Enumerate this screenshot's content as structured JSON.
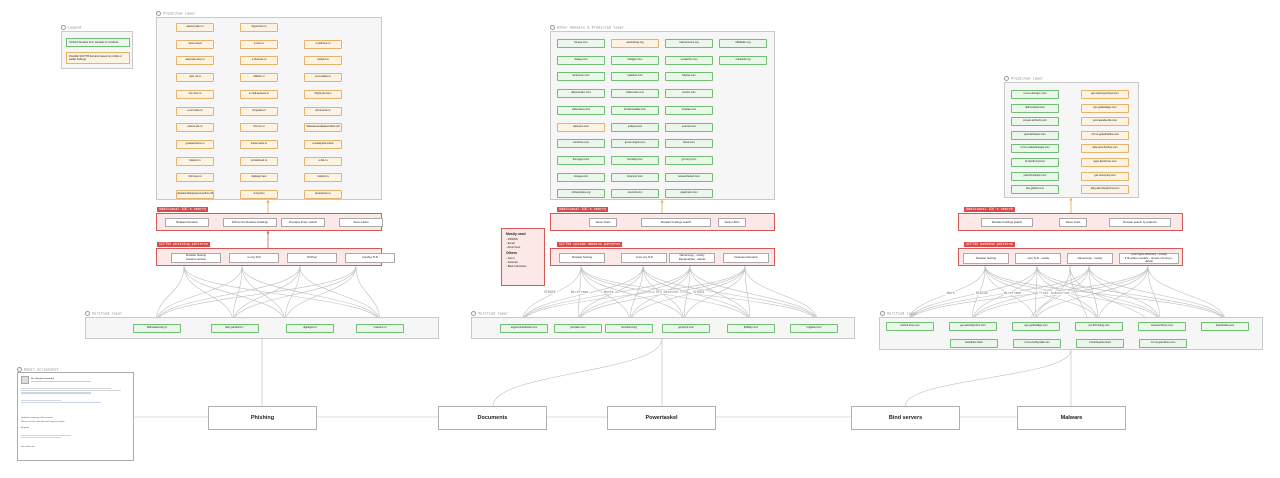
{
  "legend": {
    "title": "Legend",
    "verified_text": "Verified domains from samples or incidents",
    "predicted_text": "Possible SCF755 domains based on profile or earlier findings",
    "colors": {
      "verified": "#6fbf73",
      "predicted": "#e6b36a",
      "pivot": "#d45a5a"
    }
  },
  "panels": {
    "predicted_left": "Predicted layer",
    "verified_left": "Verified layer",
    "predicted_mid": "Other domains & Predicted layer",
    "verified_mid": "Verified layer",
    "predicted_right": "Predicted layer",
    "verified_right": "Verified layer"
  },
  "left": {
    "predicted": [
      [
        "ateonymdex.ru",
        "frepsit-link.ru",
        ""
      ],
      [
        "ndmo-cevel",
        "k-rbto.ru",
        "e-redirune.ru"
      ],
      [
        "aetyrode-drop.ru",
        "e-thuouse.ru",
        "roodpro.ru"
      ],
      [
        "urpu-rut.ru",
        "lsBode.ru",
        "a-vnnuldee.ru"
      ],
      [
        "rko-mho.ru",
        "e-mail-apesent.ru",
        "bbght-pro.item"
      ],
      [
        "e-mrrmdse.ru",
        "rctrposite.ru",
        "dnrumente.ru"
      ],
      [
        "otecne-ide.ru",
        "flum-fo.ru",
        "flldsealumestlpaeecodins.zdl"
      ],
      [
        "gruwael-there.ru",
        "tracte-todrs.ru",
        "e-rkeafpeds.online"
      ],
      [
        "tolelent.ru",
        "st-facebook.ru",
        "e-flat.ru"
      ],
      [
        "rcbrmeve.ru",
        "digiteign.item",
        "modpro.ru"
      ],
      [
        "tsbadeendlestpoeomoedins.zdl",
        "d-iny.item",
        "preesdmen.ru"
      ]
    ],
    "pivot_title": "Additional IOC's search",
    "pivots": [
      "Related Domains",
      "DrPost Xiu Russian Holdings",
      "Domains Frazy search",
      "Same Hosts"
    ],
    "patterns_title": "SCF755 phishing patterns",
    "patterns": [
      "Russian hosting\nAmazon service",
      "ru.org TLD",
      "DrrPost",
      "Another TLD"
    ],
    "verified": [
      "dibfusasecurity.ru",
      "dels-yandexl.fo...",
      "digitelgov.ru",
      "mseezur.ru"
    ]
  },
  "mid": {
    "predicted": [
      [
        "frontpe.com",
        "wonkelmay.org",
        "trabconcoms.org",
        "lt9bdadic.org"
      ],
      [
        "drapey.com",
        "heltigen.com",
        "eovlacrhn.com",
        "ntlefetshi.org"
      ],
      [
        "lambenen.com",
        "caladent.com",
        "bbpfas.com",
        ""
      ],
      [
        "lablyuenden.com",
        "callenrules.com",
        "orentm.com",
        ""
      ],
      [
        "wabrudees.com",
        "buntlemuelder.com",
        "rlroatae.com",
        ""
      ],
      [
        "adreeten.com",
        "jordpea.com",
        "enenstr.com",
        ""
      ],
      [
        "comtbore.com",
        "govermingrls.com",
        "flowtr.com",
        ""
      ],
      [
        "dompgen.com",
        "lornelbiy.com",
        "gmmmy.com",
        ""
      ],
      [
        "storgee.com",
        "bopcsort.com",
        "teteeerifested.com",
        ""
      ],
      [
        "inflowenlpes.org",
        "oevcndi.com",
        "papdnstor.com",
        ""
      ]
    ],
    "predicted_kind": [
      [
        "v",
        "p",
        "v",
        "v"
      ],
      [
        "v",
        "v",
        "v",
        "v"
      ],
      [
        "v",
        "v",
        "v",
        ""
      ],
      [
        "v",
        "v",
        "v",
        ""
      ],
      [
        "v",
        "v",
        "v",
        ""
      ],
      [
        "p",
        "v",
        "v",
        ""
      ],
      [
        "v",
        "v",
        "v",
        ""
      ],
      [
        "v",
        "v",
        "v",
        ""
      ],
      [
        "v",
        "v",
        "v",
        ""
      ],
      [
        "v",
        "v",
        "v",
        ""
      ]
    ],
    "pivot_title": "Additional IOC's search",
    "pivots": [
      "Same hosts",
      "Russian hostings search",
      "Same URLs"
    ],
    "patterns_title": "SCF755 upload domains patterns",
    "patterns": [
      "Russian hosting",
      ".com/.org TLD",
      "Name/copy - mostly\nfilename(file) - defeat",
      "Overused domains"
    ],
    "branch_labels": [
      "VIRUSE",
      "Wireframe",
      "Waste",
      "GFX Detector",
      "VIRUSE"
    ],
    "verified": [
      "avgservicesdsoke.com",
      "jerareke.com",
      "renonlend.org",
      "gerpocnt.com",
      "flnffidey.com",
      "rnlgeloe.com"
    ]
  },
  "mostly": {
    "title1": "Mostly used",
    "items1": [
      "- DDDNS",
      "- Email",
      "- Ahornhost"
    ],
    "title2": "Others",
    "items2": [
      "- Noon",
      "- Selectel",
      "- Beat Industries"
    ]
  },
  "right": {
    "predicted": [
      [
        "roomo-deregcn.com",
        "apc-atuonypunfrew.com"
      ],
      [
        "dellrcordand.com",
        "ppc-getfieldapp.com"
      ],
      [
        "pnneet-anhordo.com",
        "ponmeesdeurds.com"
      ],
      [
        "apd-debbiearr.com",
        "rrrrmo-gebebhafloo.com"
      ],
      [
        "rrrrmo-safesdlvangel.com",
        "defe-olumbcnline.com"
      ],
      [
        "dr-ilandlrned.com",
        "regis-deirsfmoe.com"
      ],
      [
        "pelenihusfrape.com",
        "get-houd-ploy.com"
      ],
      [
        "fivo-globeli.com",
        "plbg-abumbophrrnw.com"
      ]
    ],
    "pivot_title": "Additional IOC's search",
    "pivots": [
      "Russian hostings search",
      "Same hosts",
      "Domain search by patterns"
    ],
    "patterns_title": "SCF755 backend patterns",
    "patterns": [
      "Russian hosting",
      ".com TLD - mostly",
      "Name/copy - mostly",
      "(one hyper-directory - mostly\nif fif-written module - remote mmnroy) - defeat"
    ],
    "branch_labels": [
      "Ware",
      "REDIDB",
      "Wireframe",
      "Trust Industries"
    ],
    "verified_row1": [
      "anthos-fove.com",
      "get-ashodaymhor.com",
      "apc-getfieldapp.com",
      "reo-lfif-hsding.com",
      "seentcenthree.com",
      "kraenbidse.com"
    ],
    "verified_row2": [
      "bebolbloc.fresh",
      "rrrrmo-huffeywlaf.com",
      "hronbbepola.cloud",
      "rrrrmo-getefdruo.com"
    ]
  },
  "flow": {
    "stages": [
      "Phishing",
      "Documents",
      "Powertaskel",
      "Bind servers",
      "Malware"
    ]
  },
  "email": {
    "label": "Email screenshot",
    "subject": "Re: Sample forwarded",
    "line1": "Updated summary of the request",
    "line2": "Please see the attached and reply if possible.",
    "signoff": "Regards",
    "footer": "Sent with care"
  }
}
